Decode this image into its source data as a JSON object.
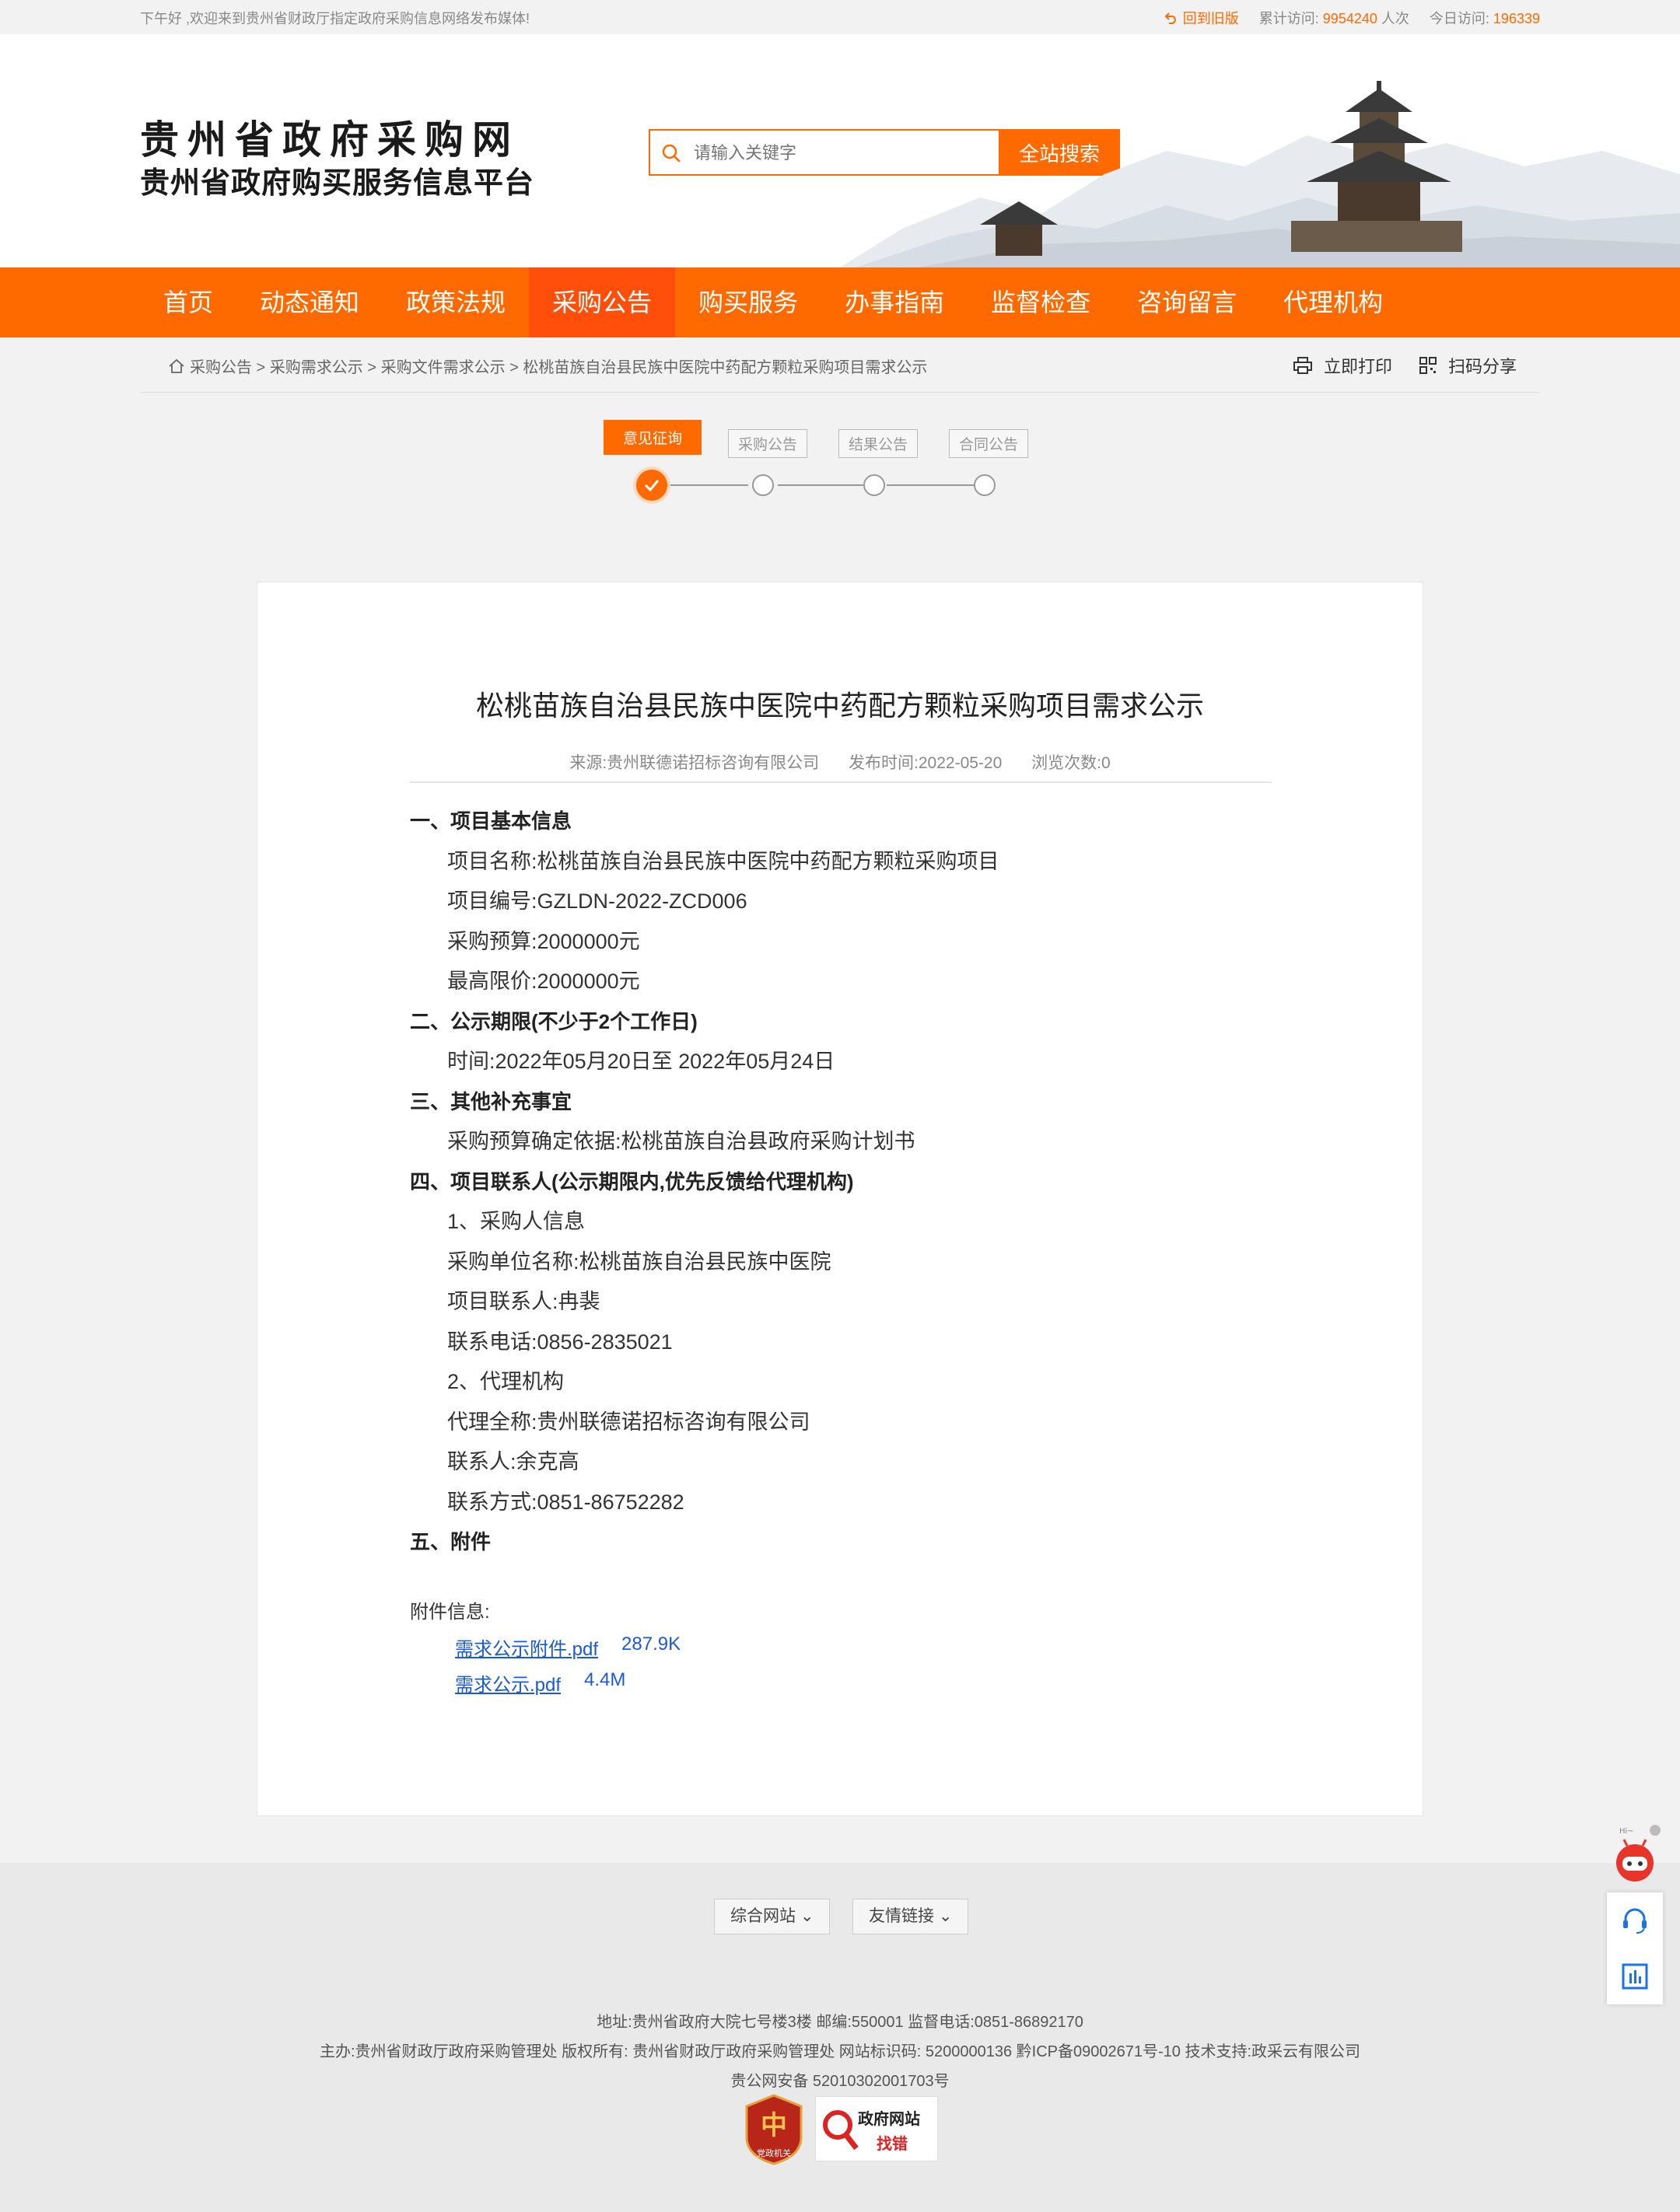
{
  "topbar": {
    "welcome": "下午好 ,欢迎来到贵州省财政厅指定政府采购信息网络发布媒体!",
    "old_version": "回到旧版",
    "total_visits_label": "累计访问:",
    "total_visits_value": "9954240",
    "total_visits_unit": "人次",
    "today_visits_label": "今日访问:",
    "today_visits_value": "196339"
  },
  "header": {
    "site_title": "贵州省政府采购网",
    "site_subtitle": "贵州省政府购买服务信息平台",
    "search_placeholder": "请输入关键字",
    "search_button": "全站搜索"
  },
  "nav": {
    "items": [
      {
        "label": "首页"
      },
      {
        "label": "动态通知"
      },
      {
        "label": "政策法规"
      },
      {
        "label": "采购公告",
        "active": true
      },
      {
        "label": "购买服务"
      },
      {
        "label": "办事指南"
      },
      {
        "label": "监督检查"
      },
      {
        "label": "咨询留言"
      },
      {
        "label": "代理机构"
      }
    ]
  },
  "breadcrumb": {
    "text": "采购公告 > 采购需求公示 > 采购文件需求公示 > 松桃苗族自治县民族中医院中药配方颗粒采购项目需求公示",
    "print": "立即打印",
    "share": "扫码分享"
  },
  "steps": {
    "items": [
      "意见征询",
      "采购公告",
      "结果公告",
      "合同公告"
    ],
    "active_index": 0
  },
  "article": {
    "title": "松桃苗族自治县民族中医院中药配方颗粒采购项目需求公示",
    "source": "来源:贵州联德诺招标咨询有限公司",
    "publish_time": "发布时间:2022-05-20",
    "views": "浏览次数:0",
    "lines": [
      {
        "type": "h",
        "text": "一、项目基本信息"
      },
      {
        "type": "p",
        "text": "项目名称:松桃苗族自治县民族中医院中药配方颗粒采购项目"
      },
      {
        "type": "p",
        "text": "项目编号:GZLDN-2022-ZCD006"
      },
      {
        "type": "p",
        "text": "采购预算:2000000元"
      },
      {
        "type": "p",
        "text": "最高限价:2000000元"
      },
      {
        "type": "h",
        "text": "二、公示期限(不少于2个工作日)"
      },
      {
        "type": "p",
        "text": "时间:2022年05月20日至 2022年05月24日"
      },
      {
        "type": "h",
        "text": "三、其他补充事宜"
      },
      {
        "type": "p",
        "text": "采购预算确定依据:松桃苗族自治县政府采购计划书"
      },
      {
        "type": "h",
        "text": "四、项目联系人(公示期限内,优先反馈给代理机构)"
      },
      {
        "type": "p",
        "text": "1、采购人信息"
      },
      {
        "type": "p",
        "text": "采购单位名称:松桃苗族自治县民族中医院"
      },
      {
        "type": "p",
        "text": "项目联系人:冉裴"
      },
      {
        "type": "p",
        "text": "联系电话:0856-2835021"
      },
      {
        "type": "p",
        "text": "2、代理机构"
      },
      {
        "type": "p",
        "text": "代理全称:贵州联德诺招标咨询有限公司"
      },
      {
        "type": "p",
        "text": "联系人:余克高"
      },
      {
        "type": "p",
        "text": "联系方式:0851-86752282"
      },
      {
        "type": "h",
        "text": "五、附件"
      }
    ],
    "attachments_label": "附件信息:",
    "attachments": [
      {
        "name": "需求公示附件.pdf",
        "size": "287.9K"
      },
      {
        "name": "需求公示.pdf",
        "size": "4.4M"
      }
    ]
  },
  "footer": {
    "btn_sites": "综合网站",
    "btn_links": "友情链接",
    "line1": "地址:贵州省政府大院七号楼3楼 邮编:550001 监督电话:0851-86892170",
    "line2": "主办:贵州省财政厅政府采购管理处 版权所有: 贵州省财政厅政府采购管理处 网站标识码: 5200000136 黔ICP备09002671号-10 技术支持:政采云有限公司",
    "line3": "贵公网安备 52010302001703号",
    "badge1_text": "党政机关",
    "badge2_line1": "政府网站",
    "badge2_line2": "找错"
  },
  "widget": {
    "greeting": "Hi~"
  },
  "colors": {
    "accent": "#ff6a00",
    "nav_active": "#ff4f0a",
    "link": "#1a5ad6"
  }
}
